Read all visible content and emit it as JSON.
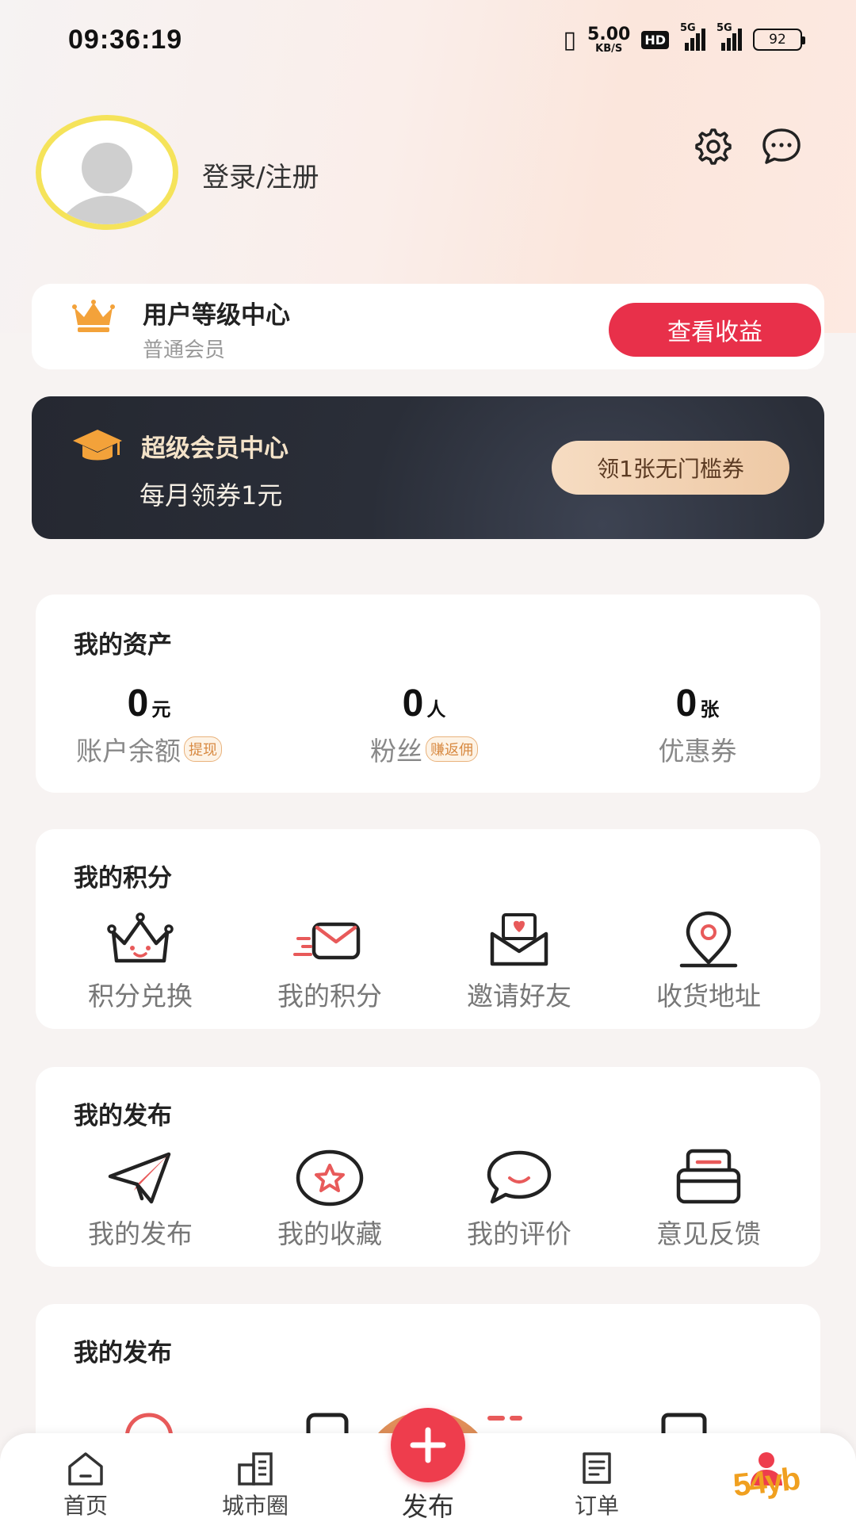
{
  "status_bar": {
    "time": "09:36:19",
    "speed_value": "5.00",
    "speed_unit": "KB/S",
    "hd": "HD",
    "signal1": "5G",
    "signal2": "5G",
    "battery": "92"
  },
  "profile": {
    "login_text": "登录/注册",
    "avatar_border_color": "#f5e35a"
  },
  "level_card": {
    "title": "用户等级中心",
    "subtitle": "普通会员",
    "button_label": "查看收益",
    "button_color": "#e8304a"
  },
  "vip_card": {
    "title": "超级会员中心",
    "subtitle": "每月领券1元",
    "button_label": "领1张无门槛券"
  },
  "assets": {
    "title": "我的资产",
    "items": [
      {
        "value": "0",
        "unit": "元",
        "label": "账户余额",
        "tag": "提现"
      },
      {
        "value": "0",
        "unit": "人",
        "label": "粉丝",
        "tag": "赚返佣"
      },
      {
        "value": "0",
        "unit": "张",
        "label": "优惠券",
        "tag": ""
      }
    ]
  },
  "points": {
    "title": "我的积分",
    "items": [
      {
        "label": "积分兑换",
        "icon": "crown-face-icon"
      },
      {
        "label": "我的积分",
        "icon": "mail-fast-icon"
      },
      {
        "label": "邀请好友",
        "icon": "envelope-heart-icon"
      },
      {
        "label": "收货地址",
        "icon": "location-pin-icon"
      }
    ]
  },
  "publish": {
    "title": "我的发布",
    "items": [
      {
        "label": "我的发布",
        "icon": "paper-plane-icon"
      },
      {
        "label": "我的收藏",
        "icon": "star-circle-icon"
      },
      {
        "label": "我的评价",
        "icon": "chat-smile-icon"
      },
      {
        "label": "意见反馈",
        "icon": "feedback-box-icon"
      }
    ]
  },
  "more": {
    "title": "我的发布"
  },
  "tab_bar": {
    "home": "首页",
    "city": "城市圈",
    "publish": "发布",
    "orders": "订单",
    "accent": "#ee3d4d"
  },
  "watermark": "54yb"
}
